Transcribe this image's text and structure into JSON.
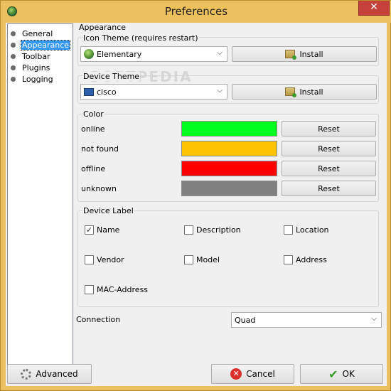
{
  "window": {
    "title": "Preferences",
    "close_glyph": "✕"
  },
  "sidebar": {
    "items": [
      {
        "label": "General"
      },
      {
        "label": "Appearance"
      },
      {
        "label": "Toolbar"
      },
      {
        "label": "Plugins"
      },
      {
        "label": "Logging"
      }
    ],
    "selected": "Appearance"
  },
  "appearance": {
    "section_title": "Appearance",
    "icon_theme": {
      "label": "Icon Theme (requires restart)",
      "value": "Elementary",
      "install_label": "Install"
    },
    "device_theme": {
      "label": "Device Theme",
      "value": "cisco",
      "install_label": "Install"
    },
    "color": {
      "label": "Color",
      "rows": [
        {
          "label": "online",
          "color": "#00ff1e",
          "reset_label": "Reset"
        },
        {
          "label": "not found",
          "color": "#ffc300",
          "reset_label": "Reset"
        },
        {
          "label": "offline",
          "color": "#ff0000",
          "reset_label": "Reset"
        },
        {
          "label": "unknown",
          "color": "#808080",
          "reset_label": "Reset"
        }
      ]
    },
    "device_label": {
      "label": "Device Label",
      "options": [
        {
          "label": "Name",
          "checked": true
        },
        {
          "label": "Description",
          "checked": false
        },
        {
          "label": "Location",
          "checked": false
        },
        {
          "label": "Vendor",
          "checked": false
        },
        {
          "label": "Model",
          "checked": false
        },
        {
          "label": "Address",
          "checked": false
        },
        {
          "label": "MAC-Address",
          "checked": false
        }
      ]
    },
    "connection": {
      "label": "Connection",
      "value": "Quad"
    }
  },
  "footer": {
    "advanced_label": "Advanced",
    "cancel_label": "Cancel",
    "ok_label": "OK"
  },
  "watermark": "SOFTPEDIA",
  "colors": {
    "chrome": "#ecc05c",
    "selection": "#3399ff",
    "close": "#c7413b"
  }
}
